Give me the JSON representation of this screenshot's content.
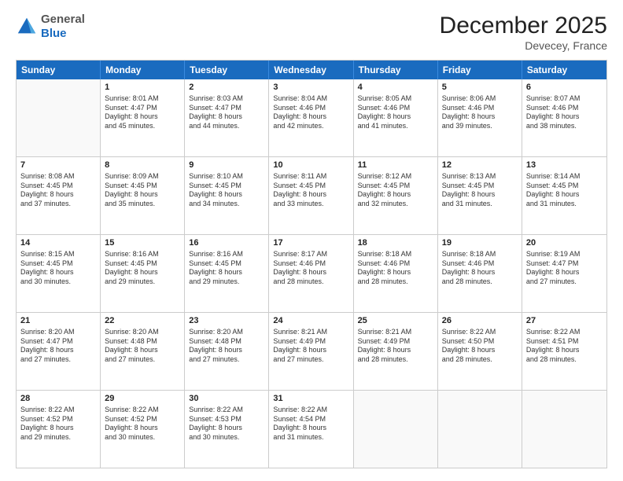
{
  "logo": {
    "general": "General",
    "blue": "Blue"
  },
  "title": "December 2025",
  "location": "Devecey, France",
  "days_of_week": [
    "Sunday",
    "Monday",
    "Tuesday",
    "Wednesday",
    "Thursday",
    "Friday",
    "Saturday"
  ],
  "weeks": [
    [
      {
        "day": "",
        "empty": true
      },
      {
        "day": "1",
        "sunrise": "Sunrise: 8:01 AM",
        "sunset": "Sunset: 4:47 PM",
        "daylight": "Daylight: 8 hours",
        "daylight2": "and 45 minutes."
      },
      {
        "day": "2",
        "sunrise": "Sunrise: 8:03 AM",
        "sunset": "Sunset: 4:47 PM",
        "daylight": "Daylight: 8 hours",
        "daylight2": "and 44 minutes."
      },
      {
        "day": "3",
        "sunrise": "Sunrise: 8:04 AM",
        "sunset": "Sunset: 4:46 PM",
        "daylight": "Daylight: 8 hours",
        "daylight2": "and 42 minutes."
      },
      {
        "day": "4",
        "sunrise": "Sunrise: 8:05 AM",
        "sunset": "Sunset: 4:46 PM",
        "daylight": "Daylight: 8 hours",
        "daylight2": "and 41 minutes."
      },
      {
        "day": "5",
        "sunrise": "Sunrise: 8:06 AM",
        "sunset": "Sunset: 4:46 PM",
        "daylight": "Daylight: 8 hours",
        "daylight2": "and 39 minutes."
      },
      {
        "day": "6",
        "sunrise": "Sunrise: 8:07 AM",
        "sunset": "Sunset: 4:46 PM",
        "daylight": "Daylight: 8 hours",
        "daylight2": "and 38 minutes."
      }
    ],
    [
      {
        "day": "7",
        "sunrise": "Sunrise: 8:08 AM",
        "sunset": "Sunset: 4:45 PM",
        "daylight": "Daylight: 8 hours",
        "daylight2": "and 37 minutes."
      },
      {
        "day": "8",
        "sunrise": "Sunrise: 8:09 AM",
        "sunset": "Sunset: 4:45 PM",
        "daylight": "Daylight: 8 hours",
        "daylight2": "and 35 minutes."
      },
      {
        "day": "9",
        "sunrise": "Sunrise: 8:10 AM",
        "sunset": "Sunset: 4:45 PM",
        "daylight": "Daylight: 8 hours",
        "daylight2": "and 34 minutes."
      },
      {
        "day": "10",
        "sunrise": "Sunrise: 8:11 AM",
        "sunset": "Sunset: 4:45 PM",
        "daylight": "Daylight: 8 hours",
        "daylight2": "and 33 minutes."
      },
      {
        "day": "11",
        "sunrise": "Sunrise: 8:12 AM",
        "sunset": "Sunset: 4:45 PM",
        "daylight": "Daylight: 8 hours",
        "daylight2": "and 32 minutes."
      },
      {
        "day": "12",
        "sunrise": "Sunrise: 8:13 AM",
        "sunset": "Sunset: 4:45 PM",
        "daylight": "Daylight: 8 hours",
        "daylight2": "and 31 minutes."
      },
      {
        "day": "13",
        "sunrise": "Sunrise: 8:14 AM",
        "sunset": "Sunset: 4:45 PM",
        "daylight": "Daylight: 8 hours",
        "daylight2": "and 31 minutes."
      }
    ],
    [
      {
        "day": "14",
        "sunrise": "Sunrise: 8:15 AM",
        "sunset": "Sunset: 4:45 PM",
        "daylight": "Daylight: 8 hours",
        "daylight2": "and 30 minutes."
      },
      {
        "day": "15",
        "sunrise": "Sunrise: 8:16 AM",
        "sunset": "Sunset: 4:45 PM",
        "daylight": "Daylight: 8 hours",
        "daylight2": "and 29 minutes."
      },
      {
        "day": "16",
        "sunrise": "Sunrise: 8:16 AM",
        "sunset": "Sunset: 4:45 PM",
        "daylight": "Daylight: 8 hours",
        "daylight2": "and 29 minutes."
      },
      {
        "day": "17",
        "sunrise": "Sunrise: 8:17 AM",
        "sunset": "Sunset: 4:46 PM",
        "daylight": "Daylight: 8 hours",
        "daylight2": "and 28 minutes."
      },
      {
        "day": "18",
        "sunrise": "Sunrise: 8:18 AM",
        "sunset": "Sunset: 4:46 PM",
        "daylight": "Daylight: 8 hours",
        "daylight2": "and 28 minutes."
      },
      {
        "day": "19",
        "sunrise": "Sunrise: 8:18 AM",
        "sunset": "Sunset: 4:46 PM",
        "daylight": "Daylight: 8 hours",
        "daylight2": "and 28 minutes."
      },
      {
        "day": "20",
        "sunrise": "Sunrise: 8:19 AM",
        "sunset": "Sunset: 4:47 PM",
        "daylight": "Daylight: 8 hours",
        "daylight2": "and 27 minutes."
      }
    ],
    [
      {
        "day": "21",
        "sunrise": "Sunrise: 8:20 AM",
        "sunset": "Sunset: 4:47 PM",
        "daylight": "Daylight: 8 hours",
        "daylight2": "and 27 minutes."
      },
      {
        "day": "22",
        "sunrise": "Sunrise: 8:20 AM",
        "sunset": "Sunset: 4:48 PM",
        "daylight": "Daylight: 8 hours",
        "daylight2": "and 27 minutes."
      },
      {
        "day": "23",
        "sunrise": "Sunrise: 8:20 AM",
        "sunset": "Sunset: 4:48 PM",
        "daylight": "Daylight: 8 hours",
        "daylight2": "and 27 minutes."
      },
      {
        "day": "24",
        "sunrise": "Sunrise: 8:21 AM",
        "sunset": "Sunset: 4:49 PM",
        "daylight": "Daylight: 8 hours",
        "daylight2": "and 27 minutes."
      },
      {
        "day": "25",
        "sunrise": "Sunrise: 8:21 AM",
        "sunset": "Sunset: 4:49 PM",
        "daylight": "Daylight: 8 hours",
        "daylight2": "and 28 minutes."
      },
      {
        "day": "26",
        "sunrise": "Sunrise: 8:22 AM",
        "sunset": "Sunset: 4:50 PM",
        "daylight": "Daylight: 8 hours",
        "daylight2": "and 28 minutes."
      },
      {
        "day": "27",
        "sunrise": "Sunrise: 8:22 AM",
        "sunset": "Sunset: 4:51 PM",
        "daylight": "Daylight: 8 hours",
        "daylight2": "and 28 minutes."
      }
    ],
    [
      {
        "day": "28",
        "sunrise": "Sunrise: 8:22 AM",
        "sunset": "Sunset: 4:52 PM",
        "daylight": "Daylight: 8 hours",
        "daylight2": "and 29 minutes."
      },
      {
        "day": "29",
        "sunrise": "Sunrise: 8:22 AM",
        "sunset": "Sunset: 4:52 PM",
        "daylight": "Daylight: 8 hours",
        "daylight2": "and 30 minutes."
      },
      {
        "day": "30",
        "sunrise": "Sunrise: 8:22 AM",
        "sunset": "Sunset: 4:53 PM",
        "daylight": "Daylight: 8 hours",
        "daylight2": "and 30 minutes."
      },
      {
        "day": "31",
        "sunrise": "Sunrise: 8:22 AM",
        "sunset": "Sunset: 4:54 PM",
        "daylight": "Daylight: 8 hours",
        "daylight2": "and 31 minutes."
      },
      {
        "day": "",
        "empty": true
      },
      {
        "day": "",
        "empty": true
      },
      {
        "day": "",
        "empty": true
      }
    ]
  ]
}
